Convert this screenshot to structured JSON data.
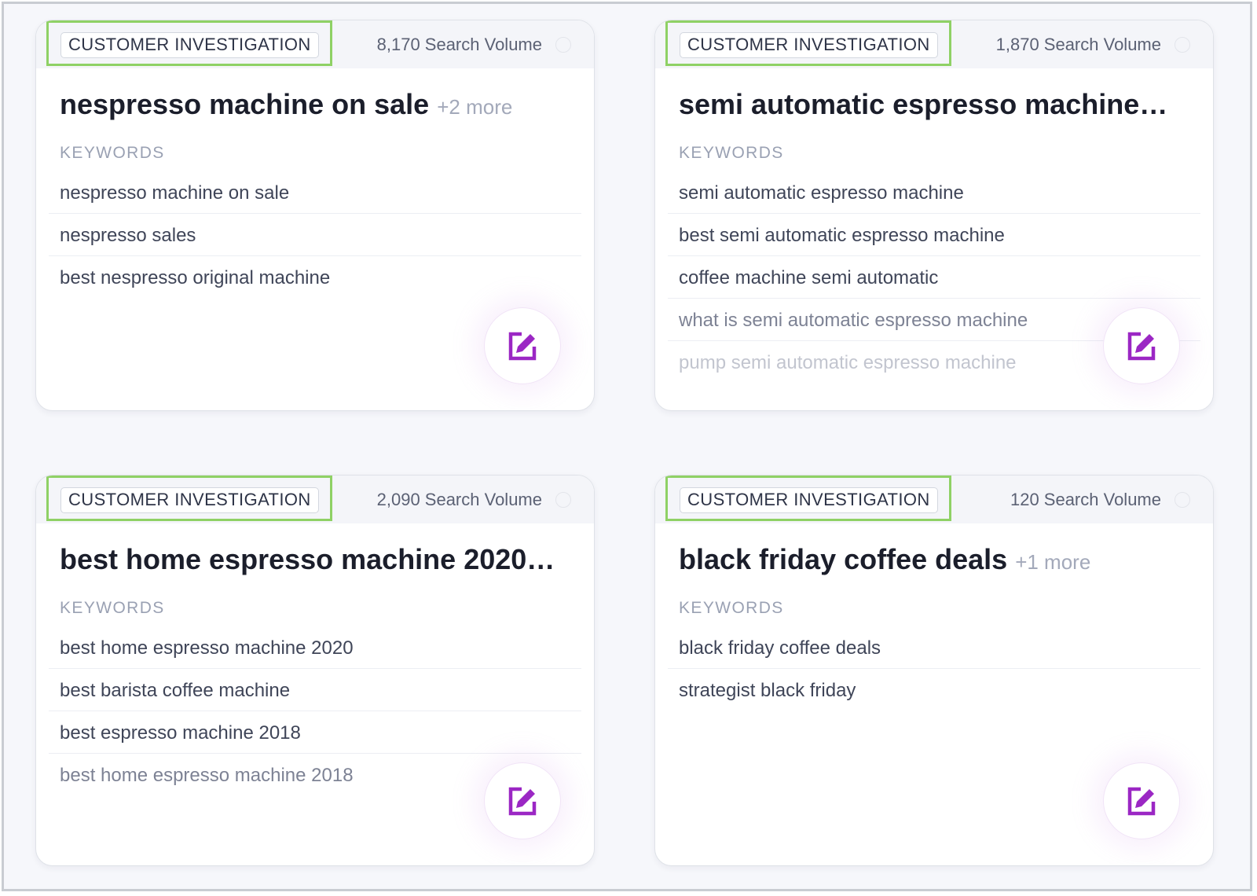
{
  "cards": [
    {
      "tag": "CUSTOMER INVESTIGATION",
      "volume": "8,170 Search Volume",
      "title": "nespresso machine on sale",
      "more": "+2 more",
      "keywords_label": "KEYWORDS",
      "keywords": [
        "nespresso machine on sale",
        "nespresso sales",
        "best nespresso original machine"
      ]
    },
    {
      "tag": "CUSTOMER INVESTIGATION",
      "volume": "1,870 Search Volume",
      "title": "semi automatic espresso machine…",
      "more": "",
      "keywords_label": "KEYWORDS",
      "keywords": [
        "semi automatic espresso machine",
        "best semi automatic espresso machine",
        "coffee machine semi automatic",
        "what is semi automatic espresso machine",
        "pump semi automatic espresso machine"
      ]
    },
    {
      "tag": "CUSTOMER INVESTIGATION",
      "volume": "2,090 Search Volume",
      "title": "best home espresso machine 2020…",
      "more": "",
      "keywords_label": "KEYWORDS",
      "keywords": [
        "best home espresso machine 2020",
        "best barista coffee machine",
        "best espresso machine 2018",
        "best home espresso machine 2018"
      ]
    },
    {
      "tag": "CUSTOMER INVESTIGATION",
      "volume": "120 Search Volume",
      "title": "black friday coffee deals",
      "more": "+1 more",
      "keywords_label": "KEYWORDS",
      "keywords": [
        "black friday coffee deals",
        "strategist black friday"
      ]
    }
  ],
  "colors": {
    "highlight": "#8fd165",
    "edit_icon": "#9b27c4",
    "title_text": "#1b1e2b",
    "muted_text": "#9aa1b3"
  },
  "icons": {
    "edit": "edit-pencil-square-icon",
    "select": "select-circle-icon"
  }
}
